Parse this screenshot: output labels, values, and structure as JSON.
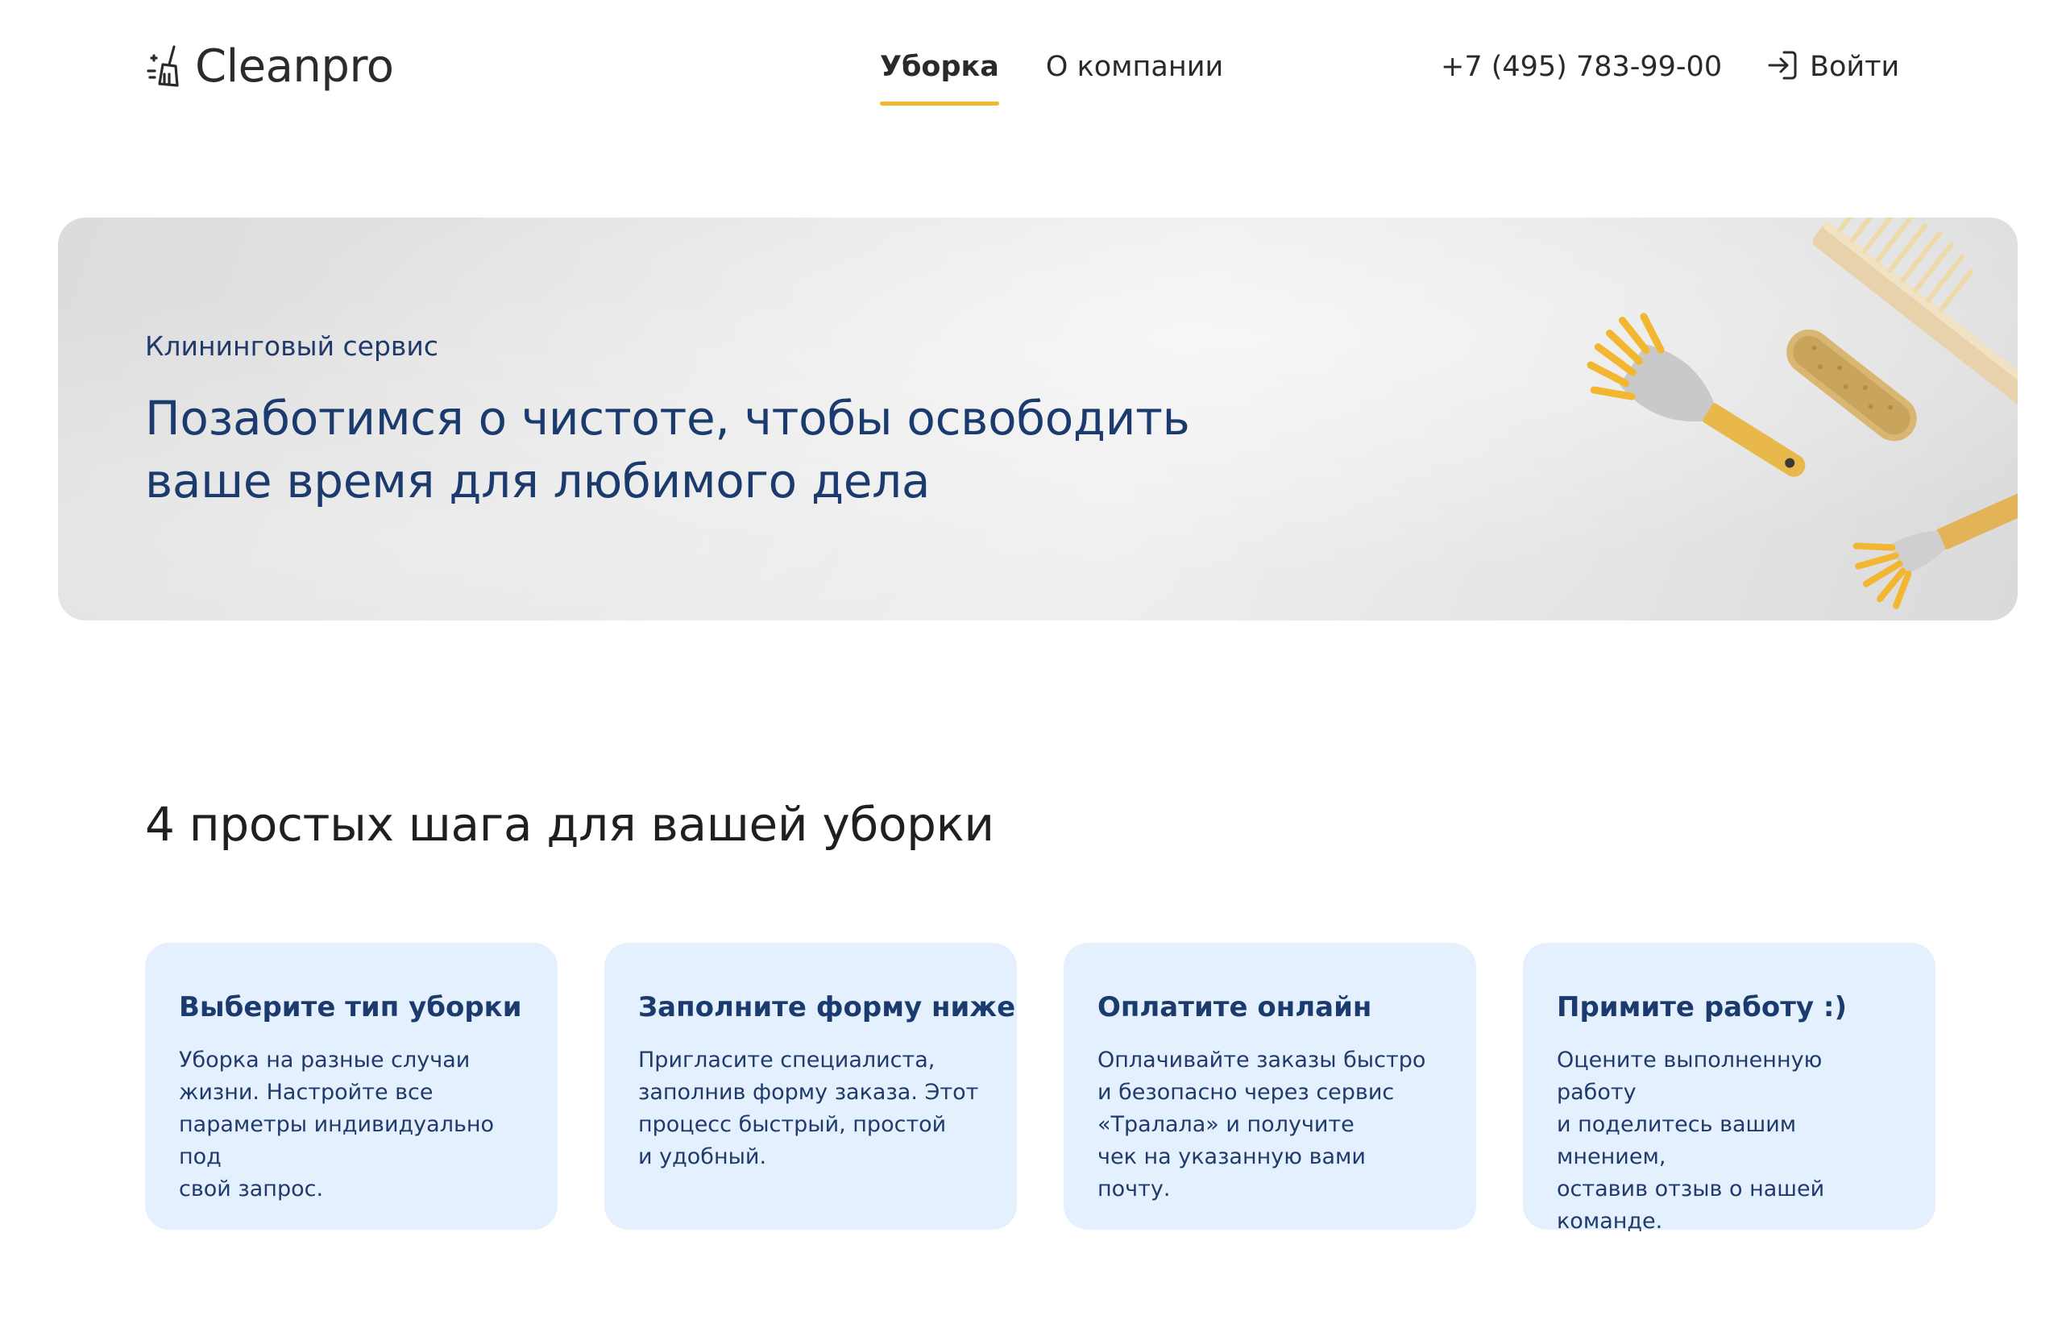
{
  "header": {
    "logo_text": "Cleanpro",
    "nav": [
      {
        "label": "Уборка",
        "active": true
      },
      {
        "label": "О компании",
        "active": false
      }
    ],
    "phone": "+7 (495) 783-99-00",
    "login_label": "Войти"
  },
  "hero": {
    "subtitle": "Клининговый сервис",
    "title": "Позаботимся о чистоте, чтобы освободить ваше время для любимого дела"
  },
  "steps": {
    "heading": "4 простых шага для вашей уборки",
    "cards": [
      {
        "title": "Выберите тип уборки",
        "text": "Уборка на разные случаи\nжизни. Настройте все\nпараметры индивидуально под\nсвой запрос."
      },
      {
        "title": "Заполните форму ниже",
        "text": "Пригласите специалиста,\nзаполнив форму заказа. Этот\nпроцесс быстрый, простой\nи удобный."
      },
      {
        "title": "Оплатите онлайн",
        "text": "Оплачивайте заказы быстро\nи безопасно через сервис\n«Тралала» и получите\nчек на указанную вами почту."
      },
      {
        "title": "Примите работу :)",
        "text": "Оцените выполненную работу\nи поделитесь вашим мнением,\nоставив отзыв о нашей\nкоманде."
      }
    ]
  },
  "colors": {
    "accent": "#f2b630",
    "brand_text": "#1b3b6f",
    "card_bg": "#e4f0fd"
  },
  "icons": {
    "logo": "broom-icon",
    "login": "sign-in-icon"
  }
}
